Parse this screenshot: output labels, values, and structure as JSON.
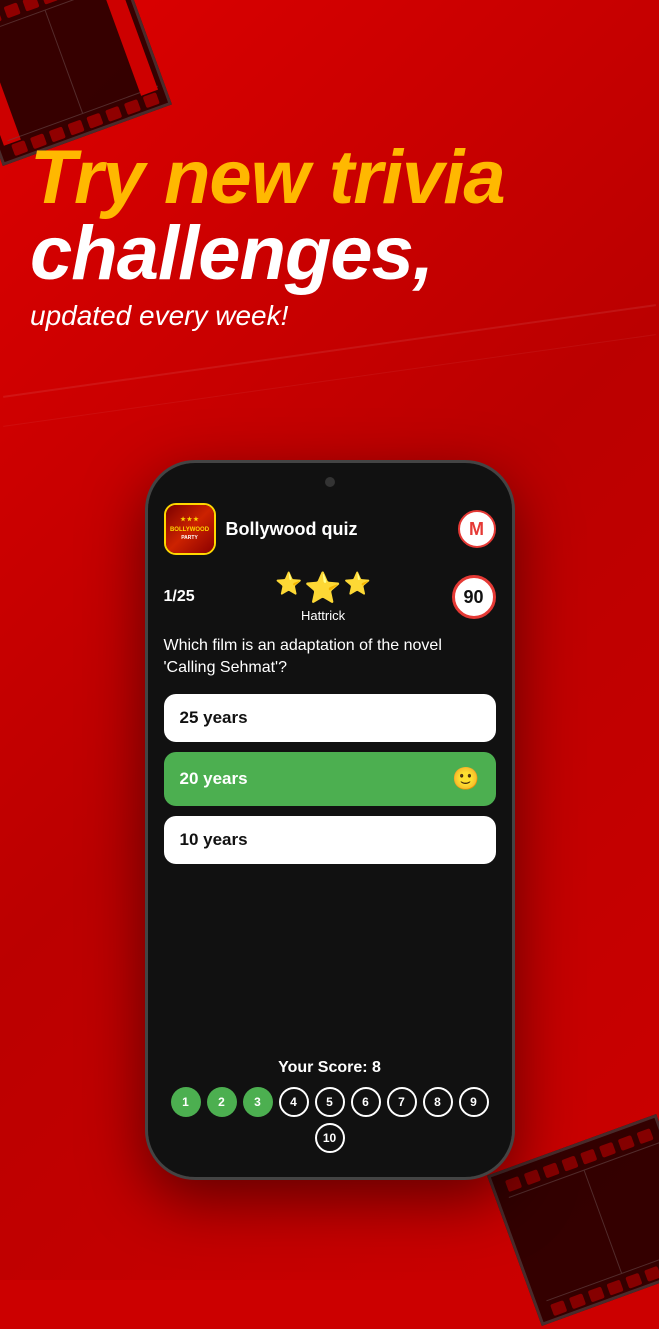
{
  "background": {
    "color": "#cc0000"
  },
  "hero": {
    "line1": "Try new trivia",
    "line2": "challenges,",
    "subtitle": "updated every week!"
  },
  "phone": {
    "quiz_icon_label": "BOLLYWOOD",
    "quiz_title": "Bollywood quiz",
    "avatar_label": "M",
    "question_number": "1/25",
    "hattrick_label": "Hattrick",
    "timer_value": "90",
    "question_text": "Which film is an adaptation of the novel 'Calling Sehmat'?",
    "answers": [
      {
        "text": "25 years",
        "style": "white",
        "emoji": ""
      },
      {
        "text": "20 years",
        "style": "green",
        "emoji": "🙂"
      },
      {
        "text": "10 years",
        "style": "white",
        "emoji": ""
      }
    ],
    "score_label": "Your Score: 8",
    "score_dots": [
      {
        "num": "1",
        "style": "filled-green"
      },
      {
        "num": "2",
        "style": "filled-green"
      },
      {
        "num": "3",
        "style": "filled-green"
      },
      {
        "num": "4",
        "style": "outline-white"
      },
      {
        "num": "5",
        "style": "outline-white"
      },
      {
        "num": "6",
        "style": "outline-white"
      },
      {
        "num": "7",
        "style": "outline-white"
      },
      {
        "num": "8",
        "style": "outline-white"
      },
      {
        "num": "9",
        "style": "outline-white"
      },
      {
        "num": "10",
        "style": "outline-white"
      }
    ]
  }
}
